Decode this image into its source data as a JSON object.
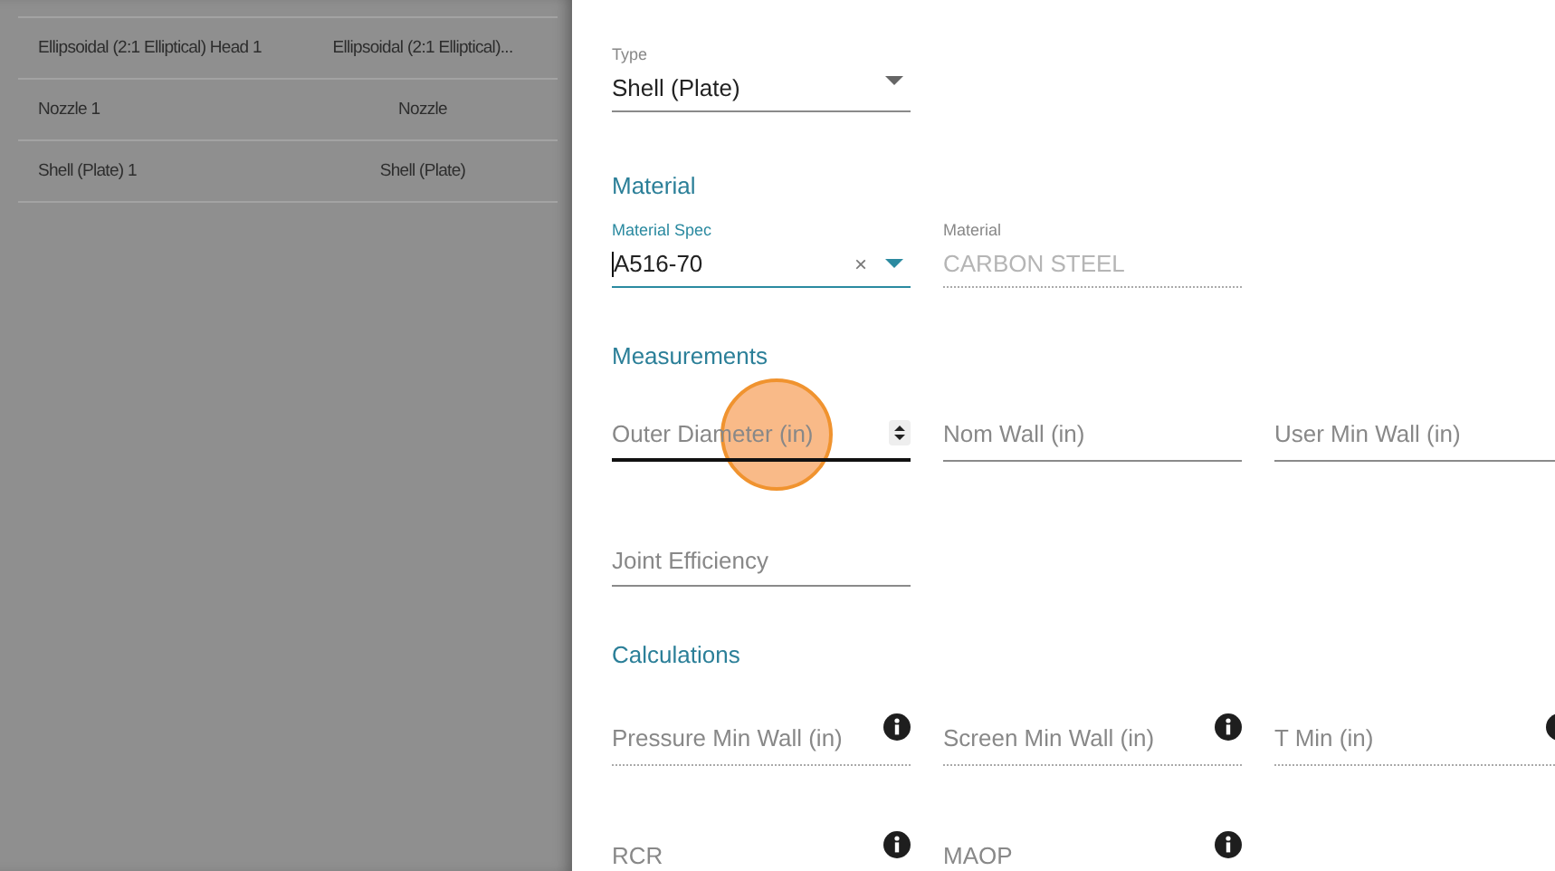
{
  "table": {
    "rows": [
      {
        "name": "Ellipsoidal (2:1 Elliptical) Head 1",
        "type": "Ellipsoidal (2:1 Elliptical)..."
      },
      {
        "name": "Nozzle 1",
        "type": "Nozzle"
      },
      {
        "name": "Shell (Plate) 1",
        "type": "Shell (Plate)"
      }
    ]
  },
  "form": {
    "type_field": {
      "label": "Type",
      "value": "Shell (Plate)"
    },
    "sections": [
      {
        "title": "Material",
        "rows": [
          [
            {
              "kind": "autocomplete",
              "label": "Material Spec",
              "value": "A516-70",
              "clear": "×",
              "focused": true
            },
            {
              "kind": "readonly",
              "label": "Material",
              "value": "CARBON STEEL"
            }
          ]
        ]
      },
      {
        "title": "Measurements",
        "rows": [
          [
            {
              "kind": "number",
              "placeholder": "Outer Diameter (in)",
              "focused": true
            },
            {
              "kind": "number",
              "placeholder": "Nom Wall (in)",
              "focused": false
            },
            {
              "kind": "number",
              "placeholder": "User Min Wall (in)",
              "focused": false
            }
          ],
          [
            {
              "kind": "number",
              "placeholder": "Joint Efficiency",
              "focused": false
            }
          ]
        ]
      },
      {
        "title": "Calculations",
        "rows": [
          [
            {
              "kind": "calc",
              "placeholder": "Pressure Min Wall (in)"
            },
            {
              "kind": "calc",
              "placeholder": "Screen Min Wall (in)"
            },
            {
              "kind": "calc",
              "placeholder": "T Min (in)"
            }
          ],
          [
            {
              "kind": "calc",
              "placeholder": "RCR"
            },
            {
              "kind": "calc",
              "placeholder": "MAOP"
            }
          ]
        ]
      }
    ]
  }
}
